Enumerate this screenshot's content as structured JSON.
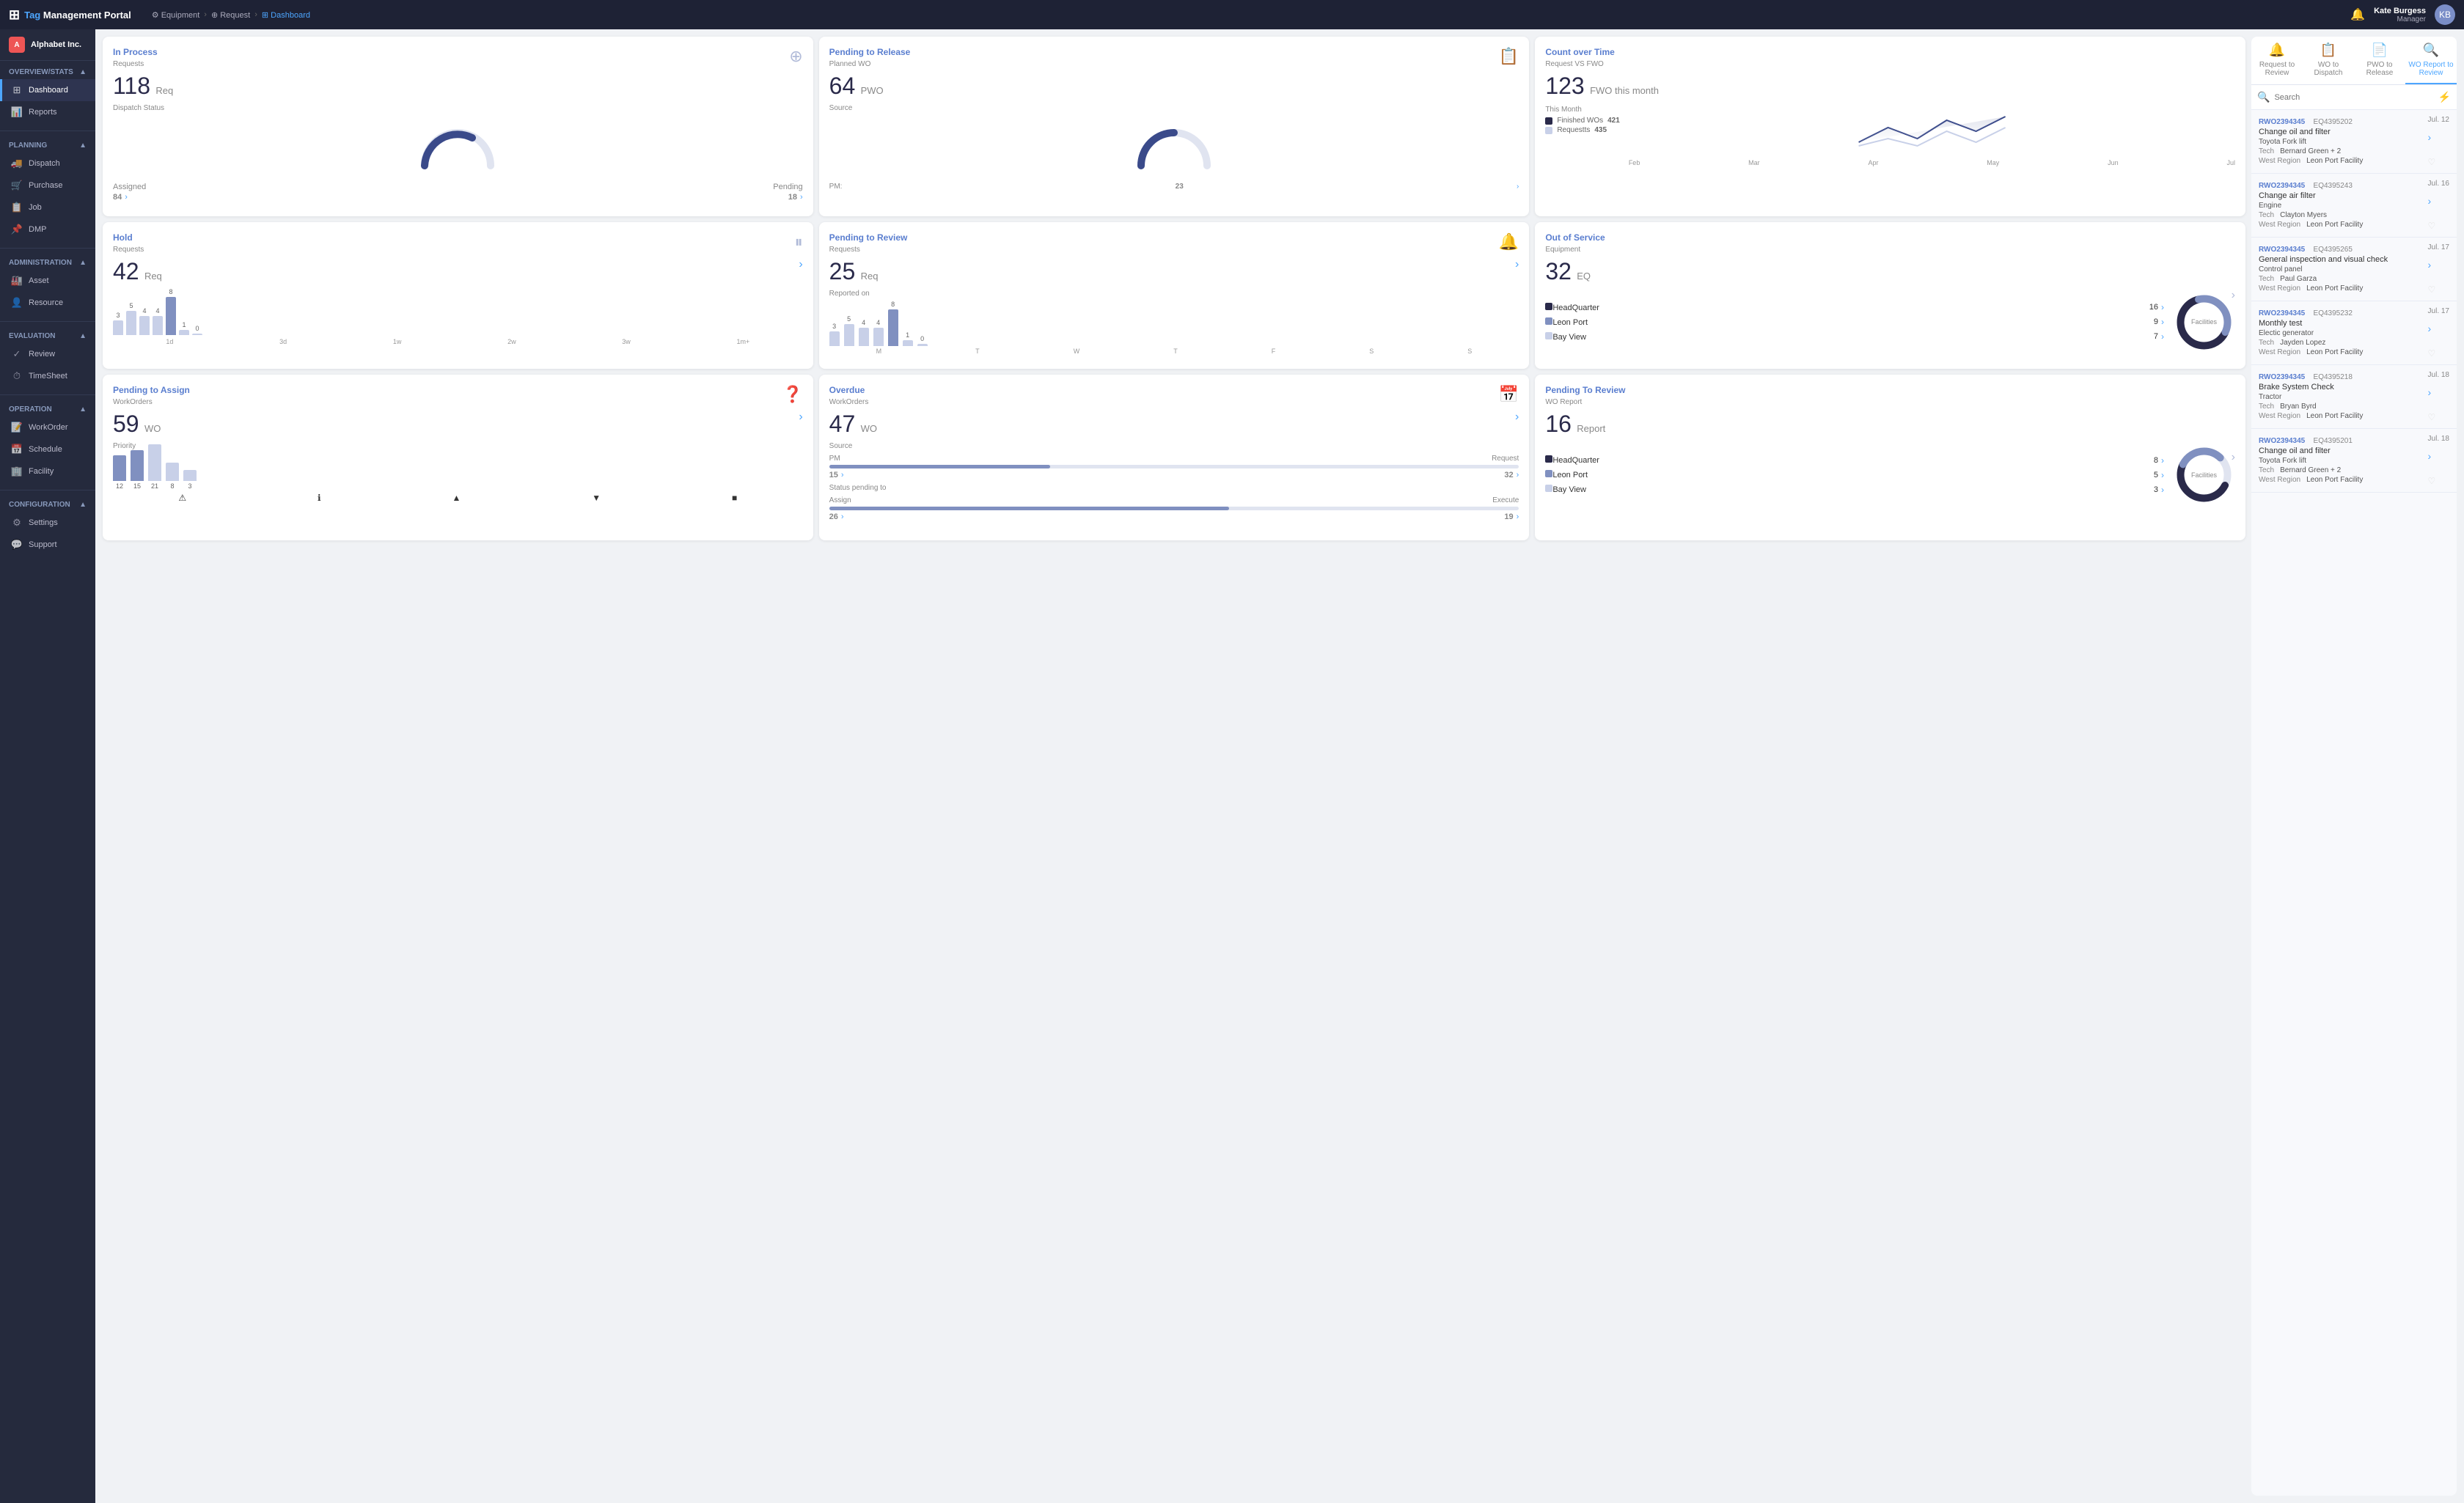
{
  "brand": {
    "tag": "Tag",
    "rest": "Management Portal"
  },
  "breadcrumb": {
    "items": [
      "Equipment",
      "Request",
      "Dashboard"
    ]
  },
  "user": {
    "name": "Kate Burgess",
    "role": "Manager"
  },
  "sidebar": {
    "company": "Alphabet Inc.",
    "sections": [
      {
        "label": "Overview/Stats",
        "items": [
          {
            "id": "dashboard",
            "label": "Dashboard",
            "active": true
          },
          {
            "id": "reports",
            "label": "Reports"
          }
        ]
      },
      {
        "label": "Planning",
        "items": [
          {
            "id": "dispatch",
            "label": "Dispatch"
          },
          {
            "id": "purchase",
            "label": "Purchase"
          },
          {
            "id": "job",
            "label": "Job"
          },
          {
            "id": "dmp",
            "label": "DMP"
          }
        ]
      },
      {
        "label": "Administration",
        "items": [
          {
            "id": "asset",
            "label": "Asset"
          },
          {
            "id": "resource",
            "label": "Resource"
          }
        ]
      },
      {
        "label": "Evaluation",
        "items": [
          {
            "id": "review",
            "label": "Review"
          },
          {
            "id": "timesheet",
            "label": "TimeSheet"
          }
        ]
      },
      {
        "label": "Operation",
        "items": [
          {
            "id": "workorder",
            "label": "WorkOrder"
          },
          {
            "id": "schedule",
            "label": "Schedule"
          },
          {
            "id": "facility",
            "label": "Facility"
          }
        ]
      },
      {
        "label": "Configuration",
        "items": [
          {
            "id": "settings",
            "label": "Settings"
          },
          {
            "id": "support",
            "label": "Support"
          }
        ]
      }
    ]
  },
  "cards": {
    "in_process": {
      "title": "In Process",
      "subtitle": "Requests",
      "number": "118",
      "unit": "Req",
      "status_label": "Dispatch Status",
      "assigned_label": "Assigned",
      "assigned_val": "84",
      "pending_label": "Pending",
      "pending_val": "18"
    },
    "pending_release": {
      "title": "Pending to Release",
      "subtitle": "Planned WO",
      "number": "64",
      "unit": "PWO",
      "source_label": "Source",
      "pm_label": "PM:",
      "pm_val": "23"
    },
    "count_over_time": {
      "title": "Count over Time",
      "subtitle": "Request VS FWO",
      "number": "123",
      "unit": "FWO this month",
      "this_month": "This Month",
      "finished_label": "Finished WOs",
      "finished_val": "421",
      "requests_label": "Requestts",
      "requests_val": "435",
      "chart_labels": [
        "Feb",
        "Mar",
        "Apr",
        "May",
        "Jun",
        "Jul"
      ]
    },
    "hold": {
      "title": "Hold",
      "subtitle": "Requests",
      "number": "42",
      "unit": "Req",
      "bar_labels": [
        "1d",
        "3d",
        "1w",
        "2w",
        "3w",
        "1m+"
      ],
      "bar_vals": [
        3,
        5,
        4,
        4,
        8,
        1,
        0
      ]
    },
    "pending_review": {
      "title": "Pending to Review",
      "subtitle": "Requests",
      "number": "25",
      "unit": "Req",
      "reported_label": "Reported on",
      "bar_labels": [
        "M",
        "T",
        "W",
        "T",
        "F",
        "S",
        "S"
      ],
      "bar_vals": [
        3,
        5,
        4,
        4,
        8,
        1,
        0
      ]
    },
    "out_of_service": {
      "title": "Out of Service",
      "subtitle": "Equipment",
      "number": "32",
      "unit": "EQ",
      "locations": [
        {
          "name": "HeadQuarter",
          "count": "16",
          "color": "#2a2a4a"
        },
        {
          "name": "Leon Port",
          "count": "9",
          "color": "#8090c0"
        },
        {
          "name": "Bay View",
          "count": "7",
          "color": "#c8d0e8"
        }
      ],
      "donut_label": "Facilities"
    },
    "pending_assign": {
      "title": "Pending to Assign",
      "subtitle": "WorkOrders",
      "number": "59",
      "unit": "WO",
      "priority_label": "Priority",
      "priority_bars": [
        12,
        15,
        21,
        8,
        3
      ],
      "priority_icons": [
        "⚠",
        "ℹ",
        "▲",
        "▼",
        "■"
      ]
    },
    "overdue": {
      "title": "Overdue",
      "subtitle": "WorkOrders",
      "number": "47",
      "unit": "WO",
      "source_label": "Source",
      "pm_label": "PM",
      "request_label": "Request",
      "pm_val": "15",
      "request_val": "32",
      "status_label": "Status pending to",
      "assign_label": "Assign",
      "execute_label": "Execute",
      "assign_val": "26",
      "execute_val": "19"
    },
    "pending_to_review_wo": {
      "title": "Pending To Review",
      "subtitle": "WO Report",
      "number": "16",
      "unit": "Report",
      "locations": [
        {
          "name": "HeadQuarter",
          "count": "8",
          "color": "#2a2a4a"
        },
        {
          "name": "Leon Port",
          "count": "5",
          "color": "#8090c0"
        },
        {
          "name": "Bay View",
          "count": "3",
          "color": "#c8d0e8"
        }
      ],
      "donut_label": "Facilities"
    }
  },
  "right_panel": {
    "tabs": [
      {
        "id": "request_review",
        "label": "Request to Review",
        "icon": "🔔"
      },
      {
        "id": "wo_dispatch",
        "label": "WO to Dispatch",
        "icon": "📋"
      },
      {
        "id": "pwo_release",
        "label": "PWO to Release",
        "icon": "📄"
      },
      {
        "id": "wo_report",
        "label": "WO Report to Review",
        "icon": "🔍",
        "active": true
      }
    ],
    "search_placeholder": "Search",
    "items": [
      {
        "wo_id": "RWO2394345",
        "desc": "Change oil and filter",
        "date": "Jul. 12",
        "eq_id": "EQ4395202",
        "eq_name": "Toyota Fork lift",
        "tech_label": "Tech",
        "tech_val": "Bernard Green + 2",
        "region_label": "West Region",
        "region_val": "Leon Port Facility"
      },
      {
        "wo_id": "RWO2394345",
        "desc": "Change air filter",
        "date": "Jul. 16",
        "eq_id": "EQ4395243",
        "eq_name": "Engine",
        "tech_label": "Tech",
        "tech_val": "Clayton Myers",
        "region_label": "West Region",
        "region_val": "Leon Port Facility"
      },
      {
        "wo_id": "RWO2394345",
        "desc": "General inspection and visual check",
        "date": "Jul. 17",
        "eq_id": "EQ4395265",
        "eq_name": "Control panel",
        "tech_label": "Tech",
        "tech_val": "Paul Garza",
        "region_label": "West Region",
        "region_val": "Leon Port Facility"
      },
      {
        "wo_id": "RWO2394345",
        "desc": "Monthly test",
        "date": "Jul. 17",
        "eq_id": "EQ4395232",
        "eq_name": "Electic generator",
        "tech_label": "Tech",
        "tech_val": "Jayden Lopez",
        "region_label": "West Region",
        "region_val": "Leon Port Facility"
      },
      {
        "wo_id": "RWO2394345",
        "desc": "Brake System Check",
        "date": "Jul. 18",
        "eq_id": "EQ4395218",
        "eq_name": "Tractor",
        "tech_label": "Tech",
        "tech_val": "Bryan Byrd",
        "region_label": "West Region",
        "region_val": "Leon Port Facility"
      },
      {
        "wo_id": "RWO2394345",
        "desc": "Change oil and filter",
        "date": "Jul. 18",
        "eq_id": "EQ4395201",
        "eq_name": "Toyota Fork lift",
        "tech_label": "Tech",
        "tech_val": "Bernard Green + 2",
        "region_label": "West Region",
        "region_val": "Leon Port Facility"
      }
    ]
  }
}
